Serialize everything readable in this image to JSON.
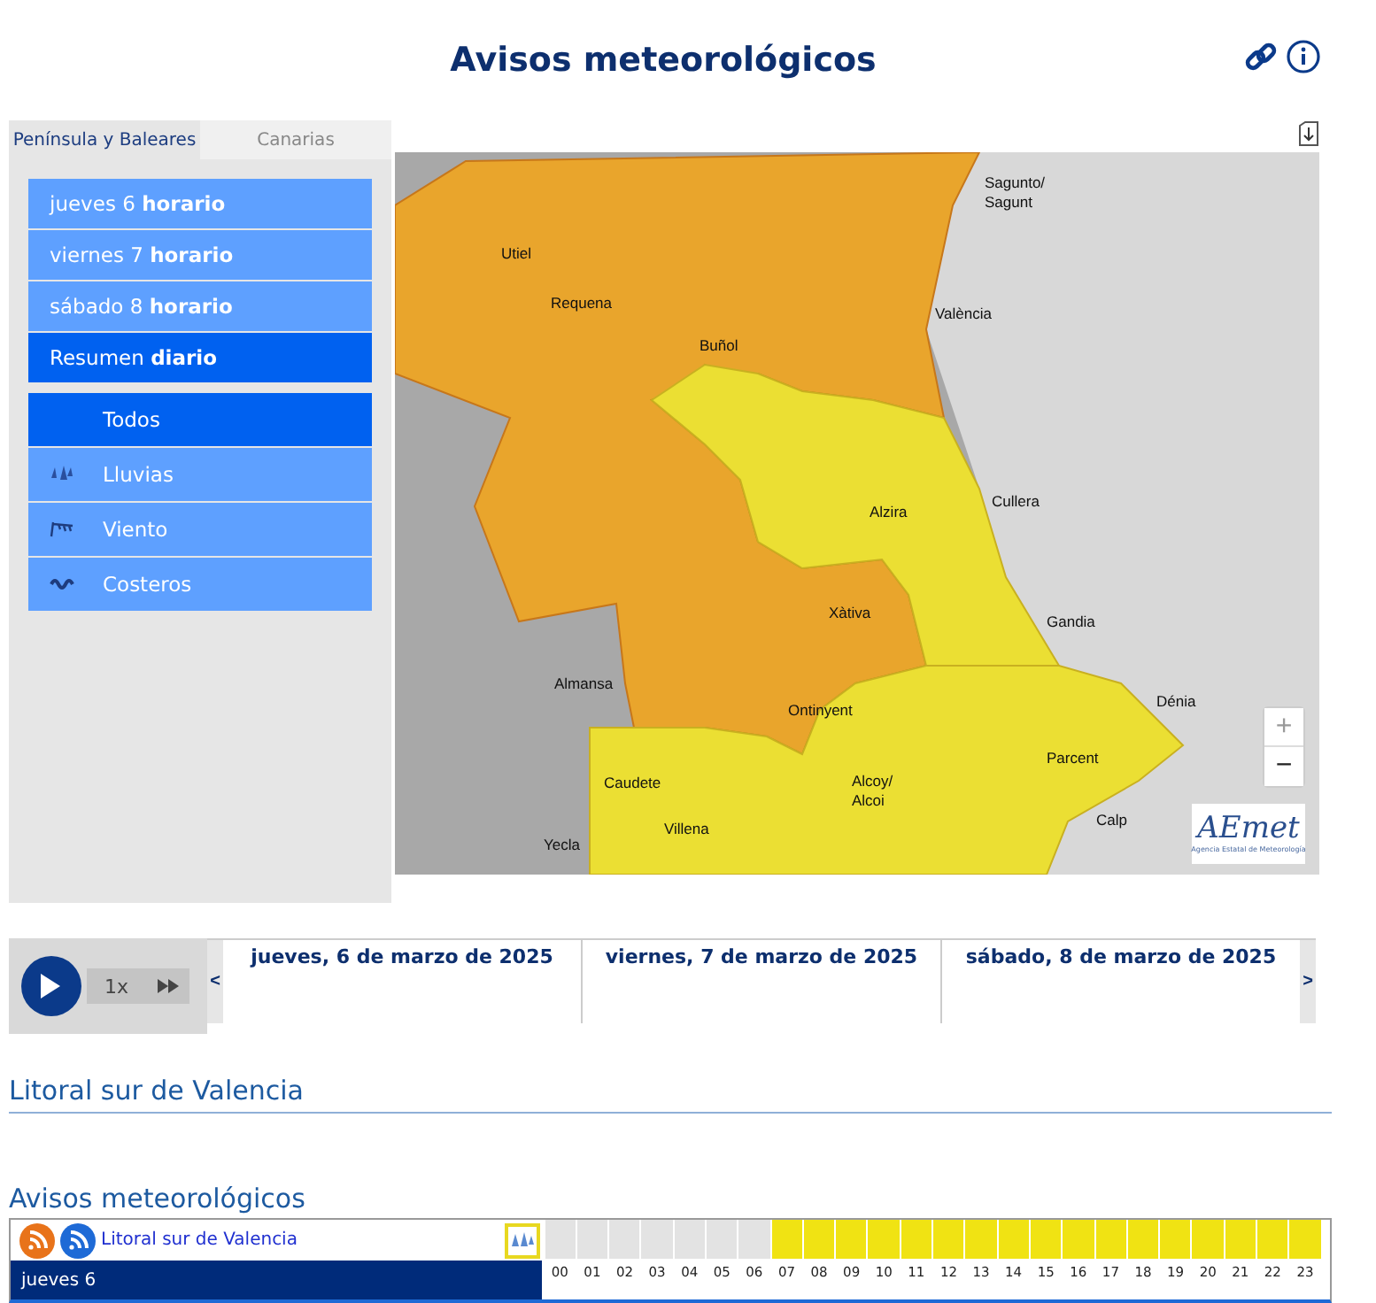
{
  "title": "Avisos meteorológicos",
  "tabs": [
    {
      "label": "Península y Baleares",
      "selected": true
    },
    {
      "label": "Canarias",
      "selected": false
    }
  ],
  "days": [
    {
      "text": "jueves 6 **horario**",
      "selected": false
    },
    {
      "text": "viernes 7 **horario**",
      "selected": false
    },
    {
      "text": "sábado 8 **horario**",
      "selected": false
    },
    {
      "text": "Resumen **diario**",
      "selected": true
    }
  ],
  "filters": [
    {
      "label": "Todos",
      "kind": "all",
      "selected": true
    },
    {
      "label": "Lluvias",
      "kind": "rain",
      "selected": false
    },
    {
      "label": "Viento",
      "kind": "wind",
      "selected": false
    },
    {
      "label": "Costeros",
      "kind": "coast",
      "selected": false
    }
  ],
  "map": {
    "places": [
      "Sagunto/ Sagunt",
      "Utiel",
      "Requena",
      "Buñol",
      "València",
      "Alzira",
      "Cullera",
      "Xàtiva",
      "Gandia",
      "Almansa",
      "Ontinyent",
      "Dénia",
      "Parcent",
      "Alcoy/ Alcoi",
      "Caudete",
      "Villena",
      "Calp",
      "Yecla"
    ],
    "zoom_in": "+",
    "zoom_out": "−",
    "logo": "AEmet",
    "logo_tagline": "Agencia Estatal de Meteorología"
  },
  "player": {
    "speed": "1x"
  },
  "timeline": {
    "prev": "<",
    "next": ">",
    "dates": [
      "jueves, 6 de marzo de 2025",
      "viernes, 7 de marzo de 2025",
      "sábado, 8 de marzo de 2025"
    ]
  },
  "zone_title": "Litoral sur de Valencia",
  "warnings": {
    "title": "Avisos meteorológicos",
    "zone_link": "Litoral sur de Valencia",
    "day": "jueves 6",
    "hours": [
      {
        "label": "00",
        "color": "#e3e3e3"
      },
      {
        "label": "01",
        "color": "#e3e3e3"
      },
      {
        "label": "02",
        "color": "#e3e3e3"
      },
      {
        "label": "03",
        "color": "#e3e3e3"
      },
      {
        "label": "04",
        "color": "#e3e3e3"
      },
      {
        "label": "05",
        "color": "#e3e3e3"
      },
      {
        "label": "06",
        "color": "#e3e3e3"
      },
      {
        "label": "07",
        "color": "#f0e313"
      },
      {
        "label": "08",
        "color": "#f0e313"
      },
      {
        "label": "09",
        "color": "#f0e313"
      },
      {
        "label": "10",
        "color": "#f0e313"
      },
      {
        "label": "11",
        "color": "#f0e313"
      },
      {
        "label": "12",
        "color": "#f0e313"
      },
      {
        "label": "13",
        "color": "#f0e313"
      },
      {
        "label": "14",
        "color": "#f0e313"
      },
      {
        "label": "15",
        "color": "#f0e313"
      },
      {
        "label": "16",
        "color": "#f0e313"
      },
      {
        "label": "17",
        "color": "#f0e313"
      },
      {
        "label": "18",
        "color": "#f0e313"
      },
      {
        "label": "19",
        "color": "#f0e313"
      },
      {
        "label": "20",
        "color": "#f0e313"
      },
      {
        "label": "21",
        "color": "#f0e313"
      },
      {
        "label": "22",
        "color": "#f0e313"
      },
      {
        "label": "23",
        "color": "#f0e313"
      }
    ]
  }
}
